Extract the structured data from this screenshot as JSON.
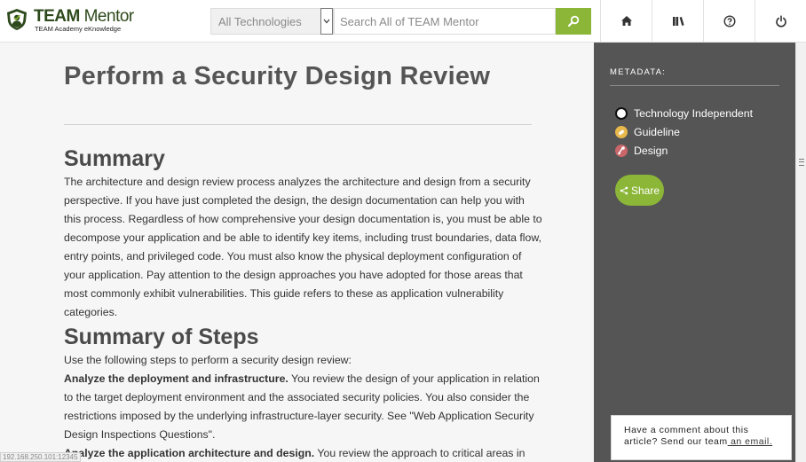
{
  "brand": {
    "title_bold": "TEAM",
    "title_rest": " Mentor",
    "subtitle": "TEAM Academy eKnowledge"
  },
  "search": {
    "technology_selected": "All Technologies",
    "placeholder": "Search All of TEAM Mentor"
  },
  "nav": [
    {
      "icon": "home-icon"
    },
    {
      "icon": "library-icon"
    },
    {
      "icon": "help-icon"
    },
    {
      "icon": "power-icon"
    }
  ],
  "article": {
    "title": "Perform a Security Design Review",
    "summary_heading": "Summary",
    "summary_text": "The architecture and design review process analyzes the architecture and design from a security perspective. If you have just completed the design, the design documentation can help you with this process. Regardless of how comprehensive your design documentation is, you must be able to decompose your application and be able to identify key items, including trust boundaries, data flow, entry points, and privileged code. You must also know the physical deployment configuration of your application. Pay attention to the design approaches you have adopted for those areas that most commonly exhibit vulnerabilities. This guide refers to these as application vulnerability categories.",
    "steps_heading": "Summary of Steps",
    "steps_intro": "Use the following steps to perform a security design review:",
    "step1_title": "Analyze the deployment and infrastructure.",
    "step1_text": " You review the design of your application in relation to the target deployment environment and the associated security policies. You also consider the restrictions imposed by the underlying infrastructure-layer security. See \"Web Application Security Design Inspections Questions\".",
    "step2_title": "Analyze the application architecture and design.",
    "step2_text": " You review the approach to critical areas in"
  },
  "sidebar": {
    "metadata_label": "METADATA:",
    "items": [
      {
        "label": "Technology Independent",
        "icon": "technology-icon",
        "color": "#ffffff"
      },
      {
        "label": "Guideline",
        "icon": "guideline-icon",
        "color": "#e8b84a"
      },
      {
        "label": "Design",
        "icon": "design-icon",
        "color": "#c9666a"
      }
    ],
    "share_label": "Share"
  },
  "comment": {
    "line1": "Have a comment about this",
    "line2": "article? Send our team",
    "link": " an email."
  },
  "status_url": "192.168.250.101:12345"
}
